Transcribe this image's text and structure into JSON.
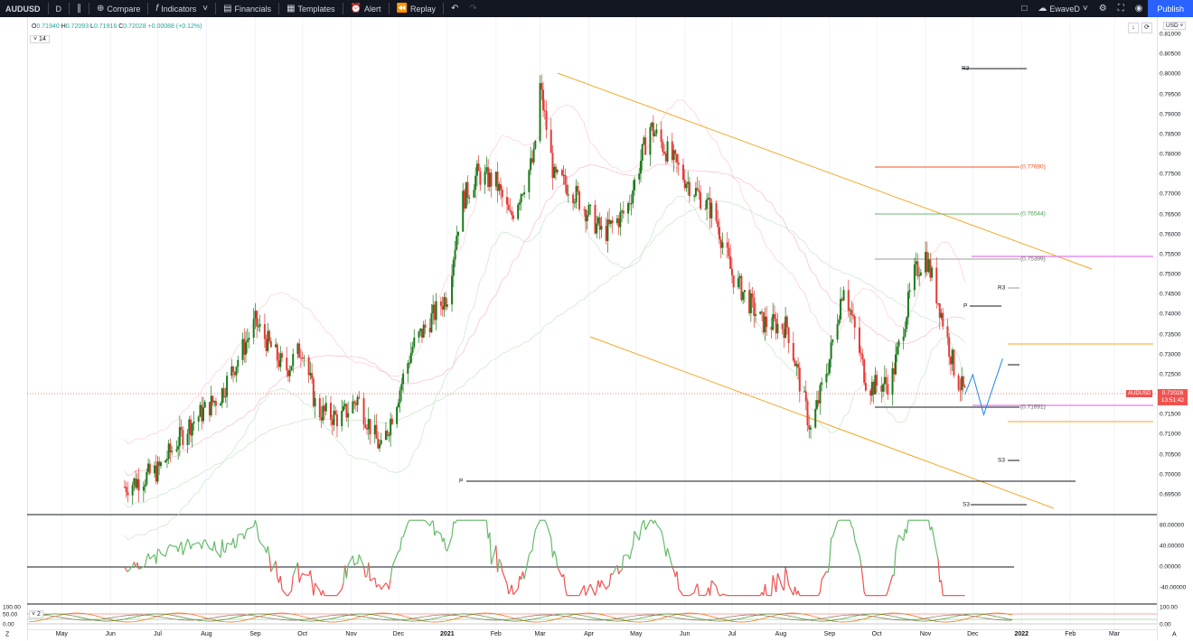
{
  "toolbar": {
    "symbol": "AUDUSD",
    "interval": "D",
    "compare": "Compare",
    "indicators": "Indicators",
    "financials": "Financials",
    "templates": "Templates",
    "alert": "Alert",
    "replay": "Replay",
    "layout_name": "EwaveD",
    "publish": "Publish"
  },
  "legend": {
    "o_lbl": "O",
    "o": "0.71940",
    "h_lbl": "H",
    "h": "0.72093",
    "l_lbl": "L",
    "l": "0.71916",
    "c_lbl": "C",
    "c": "0.72028",
    "change": "+0.00088 (+0.12%)",
    "indicator_count": "14",
    "lower_indicator_count": "2"
  },
  "axis": {
    "currency": "USD",
    "price_ticks": [
      "0.81000",
      "0.80500",
      "0.80000",
      "0.79500",
      "0.79000",
      "0.78500",
      "0.78000",
      "0.77500",
      "0.77000",
      "0.76500",
      "0.76000",
      "0.75500",
      "0.75000",
      "0.74500",
      "0.74000",
      "0.73500",
      "0.73000",
      "0.72500",
      "0.72000",
      "0.71500",
      "0.71000",
      "0.70500",
      "0.70000",
      "0.69500"
    ],
    "time_ticks": [
      "May",
      "Jun",
      "Jul",
      "Aug",
      "Sep",
      "Oct",
      "Nov",
      "Dec",
      "2021",
      "Feb",
      "Mar",
      "Apr",
      "May",
      "Jun",
      "Jul",
      "Aug",
      "Sep",
      "Oct",
      "Nov",
      "Dec",
      "2022",
      "Feb",
      "Mar"
    ],
    "osc_ticks": [
      "80.00000",
      "40.00000",
      "0.00000",
      "-40.00000"
    ],
    "osc2_ticks": [
      "100.00",
      "0.00"
    ],
    "osc2_left": [
      "100.00",
      "50.00",
      "0.00"
    ]
  },
  "last_price": {
    "symbol": "AUDUSD",
    "value": "0.72028",
    "countdown": "13:51:42"
  },
  "levels": {
    "fib_1": "(0.77690)",
    "fib_2": "(0.76544)",
    "fib_3": "(0.75399)",
    "fib_4": "(0.71691)",
    "r3_top": "R3",
    "r3_mid": "R3",
    "p_mid": "P",
    "p_low": "P",
    "s3_mid": "S3",
    "s3_low": "S3"
  },
  "colors": {
    "up": "#1b7a1b",
    "down": "#e53935",
    "channel": "#f5a623",
    "pink": "#e879e8",
    "toolbar_bg": "#131722",
    "publish_bg": "#2962ff"
  },
  "chart_data": {
    "type": "candlestick",
    "symbol": "AUDUSD",
    "interval": "D",
    "x_range": [
      "2020-04",
      "2022-03"
    ],
    "y_range": [
      0.695,
      0.81
    ],
    "path_points": [
      [
        "2020-06-10",
        0.697
      ],
      [
        "2020-07-01",
        0.701
      ],
      [
        "2020-07-20",
        0.712
      ],
      [
        "2020-08-10",
        0.72
      ],
      [
        "2020-09-01",
        0.738
      ],
      [
        "2020-09-20",
        0.726
      ],
      [
        "2020-10-01",
        0.732
      ],
      [
        "2020-10-10",
        0.716
      ],
      [
        "2020-10-25",
        0.714
      ],
      [
        "2020-11-05",
        0.719
      ],
      [
        "2020-11-20",
        0.706
      ],
      [
        "2020-12-10",
        0.732
      ],
      [
        "2021-01-01",
        0.745
      ],
      [
        "2021-01-10",
        0.768
      ],
      [
        "2021-01-20",
        0.775
      ],
      [
        "2021-02-01",
        0.773
      ],
      [
        "2021-02-10",
        0.764
      ],
      [
        "2021-02-25",
        0.779
      ],
      [
        "2021-03-01",
        0.797
      ],
      [
        "2021-03-10",
        0.774
      ],
      [
        "2021-03-20",
        0.772
      ],
      [
        "2021-04-10",
        0.76
      ],
      [
        "2021-04-25",
        0.766
      ],
      [
        "2021-05-10",
        0.787
      ],
      [
        "2021-06-01",
        0.774
      ],
      [
        "2021-06-20",
        0.765
      ],
      [
        "2021-07-01",
        0.75
      ],
      [
        "2021-07-20",
        0.738
      ],
      [
        "2021-08-05",
        0.737
      ],
      [
        "2021-08-20",
        0.711
      ],
      [
        "2021-09-01",
        0.729
      ],
      [
        "2021-09-10",
        0.748
      ],
      [
        "2021-09-25",
        0.722
      ],
      [
        "2021-10-10",
        0.723
      ],
      [
        "2021-10-25",
        0.75
      ],
      [
        "2021-11-01",
        0.755
      ],
      [
        "2021-11-10",
        0.742
      ],
      [
        "2021-11-20",
        0.725
      ],
      [
        "2021-11-26",
        0.72
      ]
    ],
    "projection": [
      [
        "2021-11-26",
        0.72
      ],
      [
        "2021-12-01",
        0.725
      ],
      [
        "2021-12-08",
        0.715
      ],
      [
        "2021-12-20",
        0.729
      ]
    ],
    "oscillator_range": [
      -60,
      100
    ]
  }
}
